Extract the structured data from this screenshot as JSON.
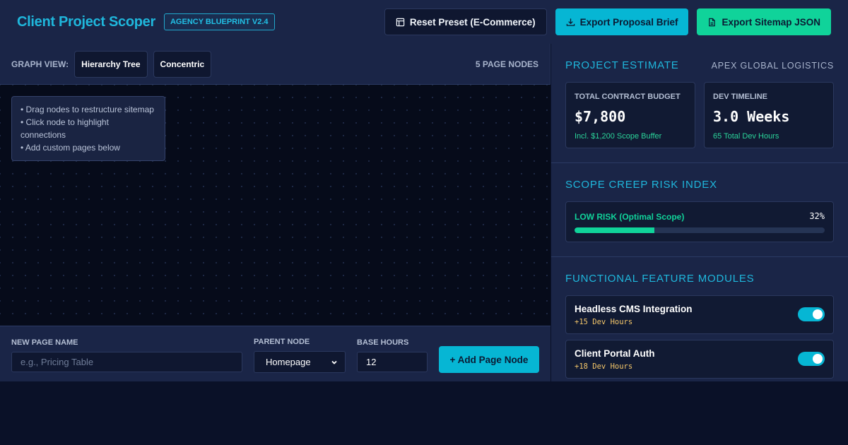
{
  "header": {
    "title": "Client Project Scoper",
    "badge": "AGENCY BLUEPRINT V2.4",
    "reset_label": "Reset Preset (E-Commerce)",
    "export_brief_label": "Export Proposal Brief",
    "export_sitemap_label": "Export Sitemap JSON"
  },
  "graph": {
    "view_label": "GRAPH VIEW:",
    "views": [
      "Hierarchy Tree",
      "Concentric"
    ],
    "node_count": "5 PAGE NODES",
    "hints": [
      "• Drag nodes to restructure sitemap",
      "• Click node to highlight connections",
      "• Add custom pages below"
    ]
  },
  "add_page": {
    "name_label": "NEW PAGE NAME",
    "name_placeholder": "e.g., Pricing Table",
    "parent_label": "PARENT NODE",
    "parent_value": "Homepage",
    "hours_label": "BASE HOURS",
    "hours_value": "12",
    "add_label": "+ Add Page Node"
  },
  "estimate": {
    "title": "PROJECT ESTIMATE",
    "client": "APEX GLOBAL LOGISTICS",
    "budget_label": "TOTAL CONTRACT BUDGET",
    "budget_value": "$7,800",
    "budget_sub": "Incl. $1,200 Scope Buffer",
    "timeline_label": "DEV TIMELINE",
    "timeline_value": "3.0 Weeks",
    "timeline_sub": "65 Total Dev Hours"
  },
  "risk": {
    "title": "SCOPE CREEP RISK INDEX",
    "level": "LOW RISK (Optimal Scope)",
    "percent_label": "32%",
    "percent": 32,
    "color": "#10d39a"
  },
  "features": {
    "title": "FUNCTIONAL FEATURE MODULES",
    "items": [
      {
        "name": "Headless CMS Integration",
        "hours": "+15 Dev Hours",
        "enabled": true
      },
      {
        "name": "Client Portal Auth",
        "hours": "+18 Dev Hours",
        "enabled": true
      }
    ]
  },
  "colors": {
    "accent": "#06b6d4",
    "success": "#10d39a",
    "warning": "#f5c76a"
  },
  "icons": {
    "reset": "layout-icon",
    "export_brief": "download-icon",
    "export_sitemap": "file-icon"
  }
}
